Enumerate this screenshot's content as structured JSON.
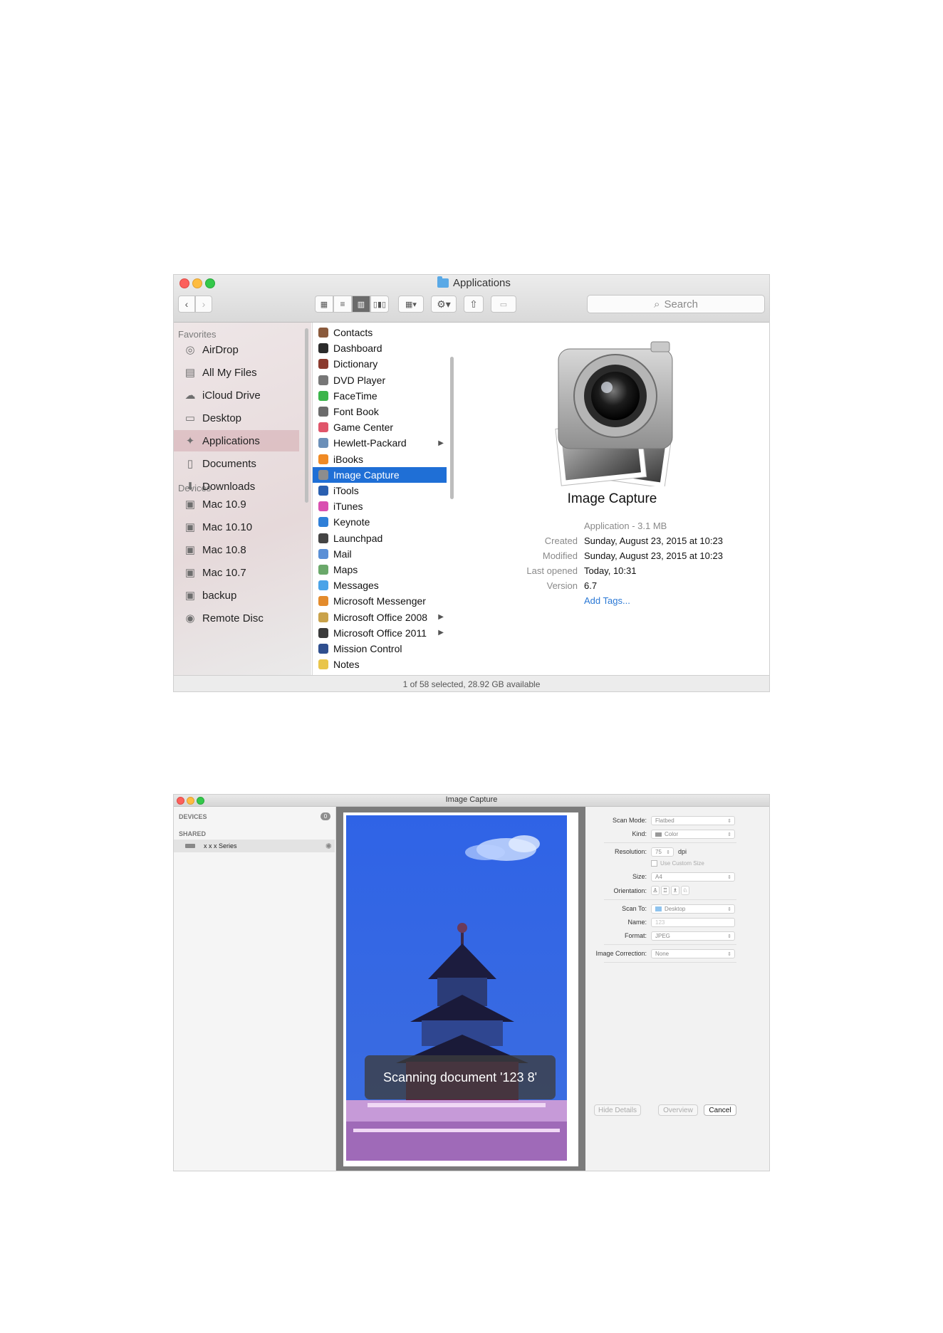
{
  "finder": {
    "title": "Applications",
    "search_placeholder": "Search",
    "sidebar": {
      "favorites_header": "Favorites",
      "favorites": [
        {
          "label": "AirDrop",
          "icon": "airdrop-icon"
        },
        {
          "label": "All My Files",
          "icon": "all-files-icon"
        },
        {
          "label": "iCloud Drive",
          "icon": "cloud-icon"
        },
        {
          "label": "Desktop",
          "icon": "desktop-icon"
        },
        {
          "label": "Applications",
          "icon": "applications-icon"
        },
        {
          "label": "Documents",
          "icon": "documents-icon"
        },
        {
          "label": "Downloads",
          "icon": "downloads-icon"
        }
      ],
      "devices_header": "Devices",
      "devices": [
        {
          "label": "Mac 10.9",
          "icon": "drive-icon"
        },
        {
          "label": "Mac 10.10",
          "icon": "drive-icon"
        },
        {
          "label": "Mac 10.8",
          "icon": "drive-icon"
        },
        {
          "label": "Mac 10.7",
          "icon": "drive-icon"
        },
        {
          "label": "backup",
          "icon": "drive-icon"
        },
        {
          "label": "Remote Disc",
          "icon": "disc-icon"
        }
      ]
    },
    "apps": [
      {
        "label": "Contacts",
        "color": "#8a5a3c"
      },
      {
        "label": "Dashboard",
        "color": "#2b2b2b"
      },
      {
        "label": "Dictionary",
        "color": "#8b3a2e"
      },
      {
        "label": "DVD Player",
        "color": "#777777"
      },
      {
        "label": "FaceTime",
        "color": "#3bb54a"
      },
      {
        "label": "Font Book",
        "color": "#6b6b6b"
      },
      {
        "label": "Game Center",
        "color": "#e0556a"
      },
      {
        "label": "Hewlett-Packard",
        "color": "#6b8fb8",
        "arrow": "▶"
      },
      {
        "label": "iBooks",
        "color": "#f08a24"
      },
      {
        "label": "Image Capture",
        "color": "#8d8d8d"
      },
      {
        "label": "iTools",
        "color": "#2a5fb0"
      },
      {
        "label": "iTunes",
        "color": "#d94fb0"
      },
      {
        "label": "Keynote",
        "color": "#2f7fd8"
      },
      {
        "label": "Launchpad",
        "color": "#444444"
      },
      {
        "label": "Mail",
        "color": "#5a8fd6"
      },
      {
        "label": "Maps",
        "color": "#6aa86a"
      },
      {
        "label": "Messages",
        "color": "#4aa3e8"
      },
      {
        "label": "Microsoft Messenger",
        "color": "#e38b2c"
      },
      {
        "label": "Microsoft Office 2008",
        "color": "#c9a24a",
        "arrow": "▶"
      },
      {
        "label": "Microsoft Office 2011",
        "color": "#3a3a3a",
        "arrow": "▶"
      },
      {
        "label": "Mission Control",
        "color": "#2f4f8f"
      },
      {
        "label": "Notes",
        "color": "#e9c54a"
      }
    ],
    "preview": {
      "name": "Image Capture",
      "kind": "Application - 3.1 MB",
      "created_label": "Created",
      "created": "Sunday, August 23, 2015 at 10:23",
      "modified_label": "Modified",
      "modified": "Sunday, August 23, 2015 at 10:23",
      "opened_label": "Last opened",
      "opened": "Today, 10:31",
      "version_label": "Version",
      "version": "6.7",
      "tags": "Add Tags..."
    },
    "status": "1 of 58 selected, 28.92 GB available"
  },
  "capture": {
    "title": "Image Capture",
    "devices_header": "DEVICES",
    "devices_count": "0",
    "shared_header": "SHARED",
    "device_name": "x x x  Series",
    "toast": "Scanning document '123 8'",
    "settings": {
      "scan_mode_label": "Scan Mode:",
      "scan_mode": "Flatbed",
      "kind_label": "Kind:",
      "kind": "Color",
      "resolution_label": "Resolution:",
      "resolution": "75",
      "dpi": "dpi",
      "custom_size": "Use Custom Size",
      "size_label": "Size:",
      "size": "A4",
      "orientation_label": "Orientation:",
      "scan_to_label": "Scan To:",
      "scan_to": "Desktop",
      "name_label": "Name:",
      "name": "123",
      "format_label": "Format:",
      "format": "JPEG",
      "correction_label": "Image Correction:",
      "correction": "None"
    },
    "buttons": {
      "hide_details": "Hide Details",
      "overview": "Overview",
      "cancel": "Cancel"
    }
  }
}
